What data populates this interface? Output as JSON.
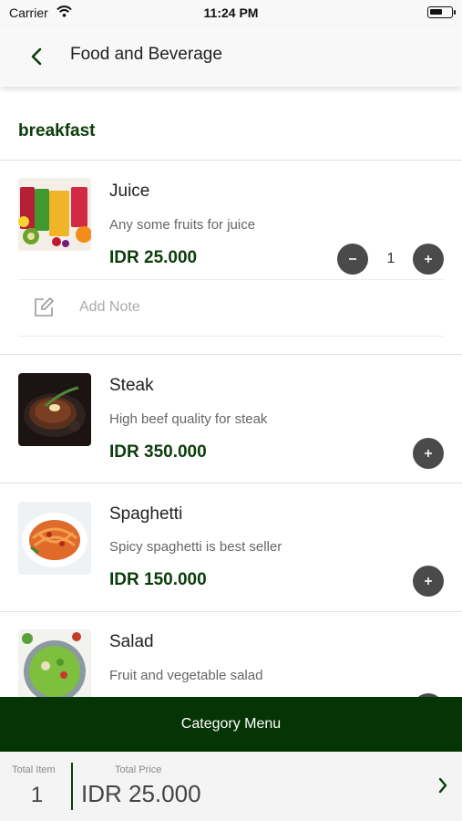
{
  "status_bar": {
    "carrier": "Carrier",
    "time": "11:24 PM",
    "battery_level": 0.6
  },
  "header": {
    "title": "Food and Beverage",
    "back_icon": "chevron-left-icon"
  },
  "category": {
    "title": "breakfast"
  },
  "items": [
    {
      "name": "Juice",
      "description": "Any some fruits for juice",
      "price": "IDR 25.000",
      "quantity": "1",
      "note_placeholder": "Add Note"
    },
    {
      "name": "Steak",
      "description": "High beef quality for steak",
      "price": "IDR 350.000"
    },
    {
      "name": "Spaghetti",
      "description": "Spicy spaghetti is best seller",
      "price": "IDR 150.000"
    },
    {
      "name": "Salad",
      "description": "Fruit and vegetable salad"
    }
  ],
  "category_menu": {
    "label": "Category Menu"
  },
  "totals": {
    "total_item_label": "Total Item",
    "total_item_value": "1",
    "total_price_label": "Total Price",
    "total_price_value": "IDR 25.000"
  },
  "colors": {
    "brand_green": "#053505",
    "price_green": "#0b3d0b",
    "button_gray": "#4a4a4a"
  }
}
